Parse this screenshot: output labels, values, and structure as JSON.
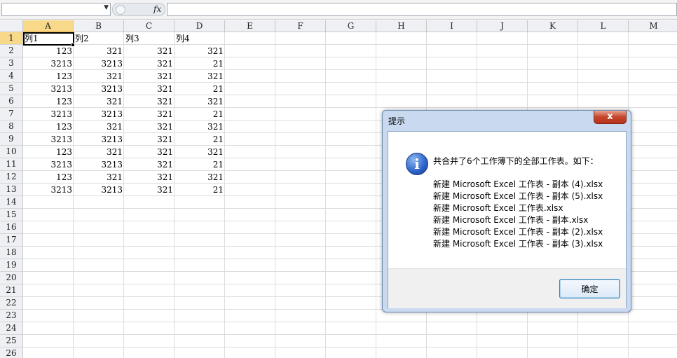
{
  "formula_bar": {
    "name_box_value": "",
    "fx_label": "fx",
    "formula_value": ""
  },
  "grid": {
    "columns": [
      "A",
      "B",
      "C",
      "D",
      "E",
      "F",
      "G",
      "H",
      "I",
      "J",
      "K",
      "L",
      "M"
    ],
    "rows": [
      "1",
      "2",
      "3",
      "4",
      "5",
      "6",
      "7",
      "8",
      "9",
      "10",
      "11",
      "12",
      "13",
      "14",
      "15",
      "16",
      "17",
      "18",
      "19",
      "20",
      "21",
      "22",
      "23",
      "24",
      "25",
      "26"
    ],
    "header_row": [
      "列1",
      "列2",
      "列3",
      "列4"
    ],
    "data_rows": [
      [
        "123",
        "321",
        "321",
        "321"
      ],
      [
        "3213",
        "3213",
        "321",
        "21"
      ],
      [
        "123",
        "321",
        "321",
        "321"
      ],
      [
        "3213",
        "3213",
        "321",
        "21"
      ],
      [
        "123",
        "321",
        "321",
        "321"
      ],
      [
        "3213",
        "3213",
        "321",
        "21"
      ],
      [
        "123",
        "321",
        "321",
        "321"
      ],
      [
        "3213",
        "3213",
        "321",
        "21"
      ],
      [
        "123",
        "321",
        "321",
        "321"
      ],
      [
        "3213",
        "3213",
        "321",
        "21"
      ],
      [
        "123",
        "321",
        "321",
        "321"
      ],
      [
        "3213",
        "3213",
        "321",
        "21"
      ]
    ],
    "active_cell": "A1"
  },
  "dialog": {
    "title": "提示",
    "close_label": "x",
    "icon": "info-icon",
    "message": "共合并了6个工作薄下的全部工作表。如下：",
    "files": [
      "新建 Microsoft Excel 工作表 - 副本 (4).xlsx",
      "新建 Microsoft Excel 工作表 - 副本 (5).xlsx",
      "新建 Microsoft Excel 工作表.xlsx",
      "新建 Microsoft Excel 工作表 - 副本.xlsx",
      "新建 Microsoft Excel 工作表 - 副本 (2).xlsx",
      "新建 Microsoft Excel 工作表 - 副本 (3).xlsx"
    ],
    "ok_label": "确定"
  }
}
